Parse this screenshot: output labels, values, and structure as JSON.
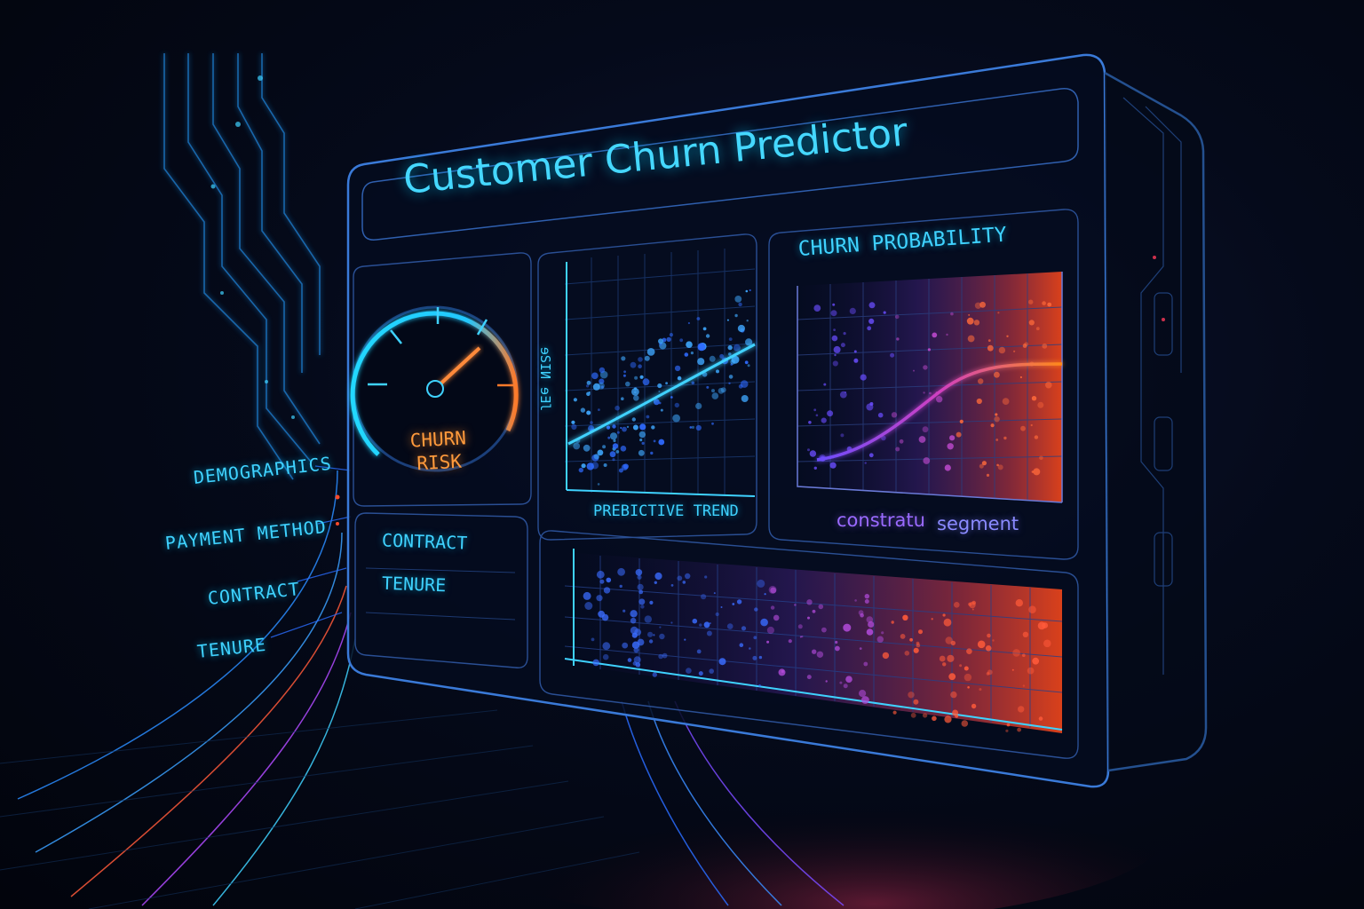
{
  "title": "Customer Churn Predictor",
  "features": [
    "DEMOGRAPHICS",
    "PAYMENT METHOD",
    "CONTRACT",
    "TENURE"
  ],
  "gauge": {
    "label_line1": "CHURN",
    "label_line2": "RISK"
  },
  "side_list": [
    "CONTRACT",
    "TENURE"
  ],
  "trend_panel": {
    "axis_label": "ɘSIИ ɘƎl",
    "xlabel": "PREBICTIVE TREND"
  },
  "probability_panel": {
    "title": "CHURN PROBABILITY",
    "legend": [
      "constratu",
      "segment"
    ]
  },
  "colors": {
    "cyan": "#3fd2ff",
    "blue": "#2f6bff",
    "purple": "#8a4dff",
    "orange": "#ff6a2a"
  }
}
